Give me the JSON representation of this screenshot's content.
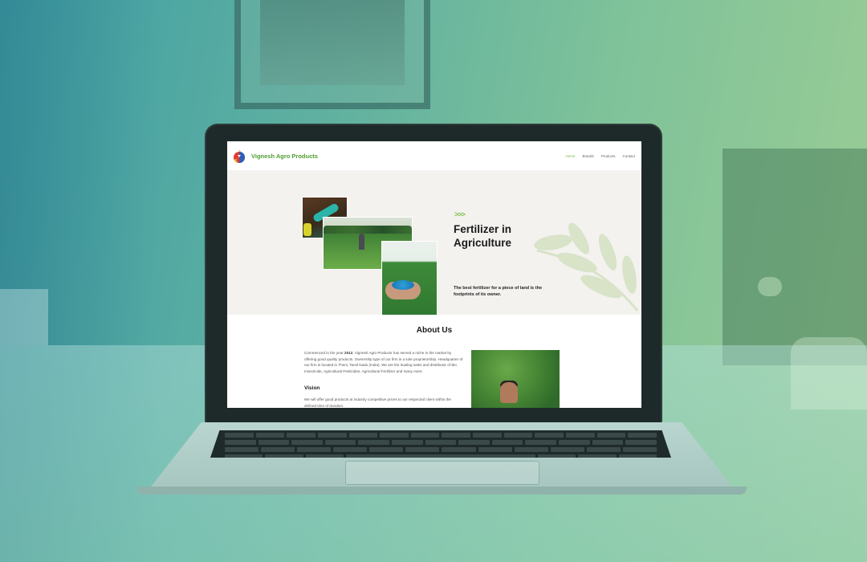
{
  "site": {
    "brand_name": "Vignesh Agro Products",
    "nav": [
      "Home",
      "Brands",
      "Products",
      "Contact"
    ],
    "active_nav": "Home"
  },
  "hero": {
    "chevrons": ">>>",
    "title": "Fertilizer in Agriculture",
    "subtitle": "The best fertilizer for a piece of land is the footprints of its owner."
  },
  "about": {
    "title": "About Us",
    "intro_prefix": "Commenced in the year ",
    "intro_year": "2012",
    "intro_body": ", Vignesh Agro Products has served a niche in the market by offering good quality products. Ownership type of our firm is a sole proprietorship. Headquarter of our firm is located in Theni, Tamil Nadu (India). We are the leading sales and distributor of Bio Insecticide, Agricultural Pesticides, Agricultural Fertilizer and many more.",
    "vision_title": "Vision",
    "vision_text": "We will offer good products at industry competitive prices to our respected client within the defined time of duration."
  },
  "colors": {
    "brand_green": "#4e9b2f",
    "accent_green": "#7cbf4e",
    "hero_bg": "#f3f2ef"
  },
  "icons": [
    "brand-logo-icon",
    "leaf-decoration-icon"
  ]
}
